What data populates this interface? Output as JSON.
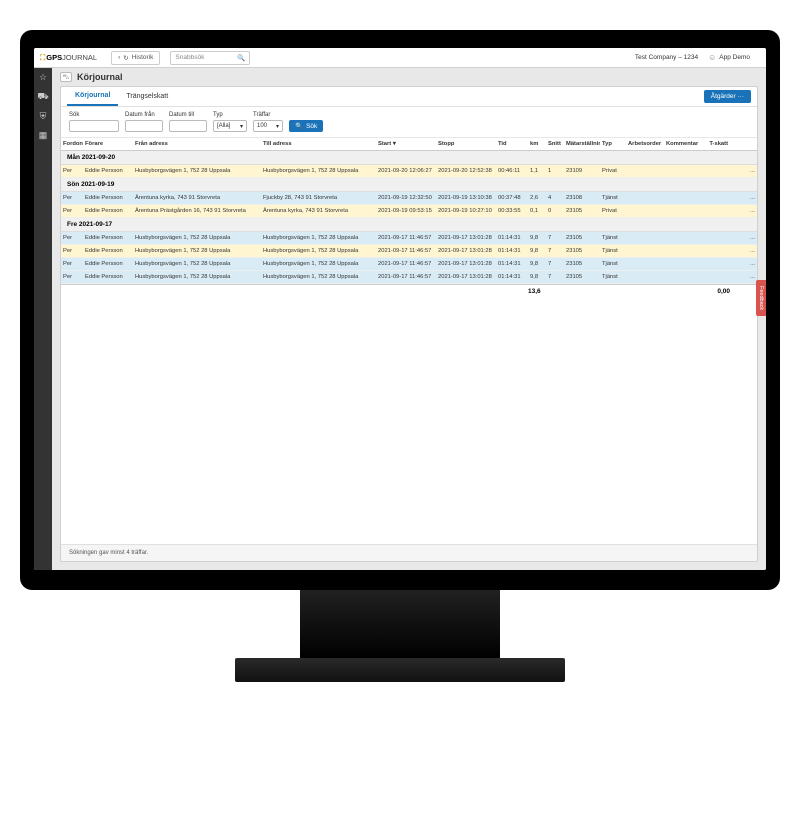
{
  "brand": {
    "g": "GPS",
    "b": "JOURNAL"
  },
  "topbar": {
    "history": "Historik",
    "quicksearch_ph": "Snabbsök",
    "company": "Test Company – 1234",
    "user": "App Demo"
  },
  "page": {
    "title": "Körjournal"
  },
  "tabs": {
    "korjournal": "Körjournal",
    "trangselskatt": "Trängselskatt",
    "actions": "Åtgärder ···"
  },
  "filters": {
    "sok": "Sök",
    "datum_fran": "Datum från",
    "datum_till": "Datum till",
    "typ": "Typ",
    "typ_val": "[Alla]",
    "traffar": "Träffar",
    "traffar_val": "100",
    "sok_btn": "Sök"
  },
  "columns": {
    "fordon": "Fordon",
    "forare": "Förare",
    "fran": "Från adress",
    "till": "Till adress",
    "start": "Start ▾",
    "stopp": "Stopp",
    "tid": "Tid",
    "km": "km",
    "snitt": "Snitt",
    "matar": "Mätarställning",
    "typ": "Typ",
    "ao": "Arbetsorder",
    "komm": "Kommentar",
    "tskatt": "T-skatt"
  },
  "groups": [
    {
      "label": "Mån 2021-09-20",
      "rows": [
        {
          "cls": "yel",
          "fordon": "Per",
          "forare": "Eddie Persson",
          "fran": "Husbyborgsvägen 1, 752 28 Uppsala",
          "till": "Husbyborgsvägen 1, 752 28 Uppsala",
          "start": "2021-09-20 12:06:27",
          "stopp": "2021-09-20 12:52:38",
          "tid": "00:46:11",
          "km": "1,1",
          "snitt": "1",
          "matar": "23109",
          "typ": "Privat"
        }
      ]
    },
    {
      "label": "Sön 2021-09-19",
      "rows": [
        {
          "cls": "blu",
          "fordon": "Per",
          "forare": "Eddie Persson",
          "fran": "Ärentuna kyrka, 743 91 Storvreta",
          "till": "Fjuckby 28, 743 91 Storvreta",
          "start": "2021-09-19 12:32:50",
          "stopp": "2021-09-19 13:10:38",
          "tid": "00:37:48",
          "km": "2,6",
          "snitt": "4",
          "matar": "23108",
          "typ": "Tjänst"
        },
        {
          "cls": "yel",
          "fordon": "Per",
          "forare": "Eddie Persson",
          "fran": "Ärentuna Prästgården 16, 743 91 Storvreta",
          "till": "Ärentuna kyrka, 743 91 Storvreta",
          "start": "2021-09-19 09:53:15",
          "stopp": "2021-09-19 10:27:10",
          "tid": "00:33:55",
          "km": "0,1",
          "snitt": "0",
          "matar": "23105",
          "typ": "Privat"
        }
      ]
    },
    {
      "label": "Fre 2021-09-17",
      "rows": [
        {
          "cls": "blu",
          "fordon": "Per",
          "forare": "Eddie Persson",
          "fran": "Husbyborgsvägen 1, 752 28 Uppsala",
          "till": "Husbyborgsvägen 1, 752 28 Uppsala",
          "start": "2021-09-17 11:46:57",
          "stopp": "2021-09-17 13:01:28",
          "tid": "01:14:31",
          "km": "9,8",
          "snitt": "7",
          "matar": "23105",
          "typ": "Tjänst"
        },
        {
          "cls": "yel",
          "fordon": "Per",
          "forare": "Eddie Persson",
          "fran": "Husbyborgsvägen 1, 752 28 Uppsala",
          "till": "Husbyborgsvägen 1, 752 28 Uppsala",
          "start": "2021-09-17 11:46:57",
          "stopp": "2021-09-17 13:01:28",
          "tid": "01:14:31",
          "km": "9,8",
          "snitt": "7",
          "matar": "23105",
          "typ": "Tjänst"
        },
        {
          "cls": "blu",
          "fordon": "Per",
          "forare": "Eddie Persson",
          "fran": "Husbyborgsvägen 1, 752 28 Uppsala",
          "till": "Husbyborgsvägen 1, 752 28 Uppsala",
          "start": "2021-09-17 11:46:57",
          "stopp": "2021-09-17 13:01:28",
          "tid": "01:14:31",
          "km": "9,8",
          "snitt": "7",
          "matar": "23105",
          "typ": "Tjänst"
        },
        {
          "cls": "blu",
          "fordon": "Per",
          "forare": "Eddie Persson",
          "fran": "Husbyborgsvägen 1, 752 28 Uppsala",
          "till": "Husbyborgsvägen 1, 752 28 Uppsala",
          "start": "2021-09-17 11:46:57",
          "stopp": "2021-09-17 13:01:28",
          "tid": "01:14:31",
          "km": "9,8",
          "snitt": "7",
          "matar": "23105",
          "typ": "Tjänst"
        }
      ]
    }
  ],
  "totals": {
    "km": "13,6",
    "tskatt": "0,00"
  },
  "footer": "Sökningen gav minst 4 träffar.",
  "feedback": "Feedback"
}
